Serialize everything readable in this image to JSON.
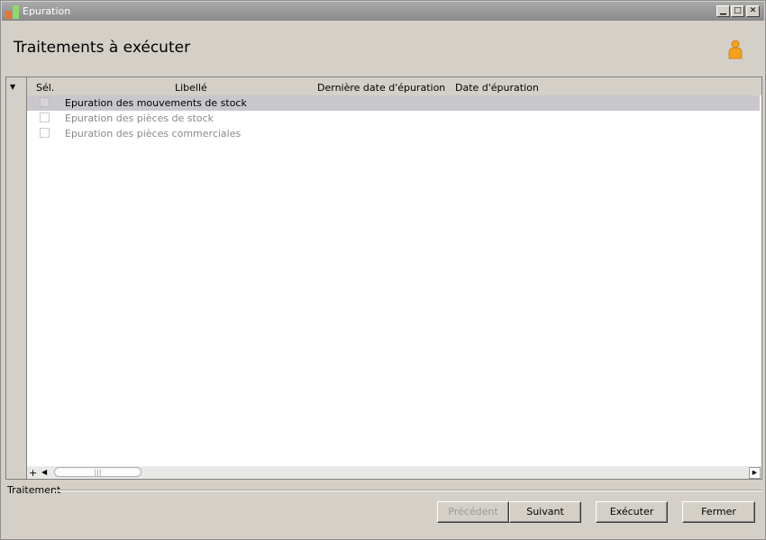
{
  "window": {
    "title": "Epuration",
    "min_glyph": "▁",
    "max_glyph": "□",
    "close_glyph": "✕"
  },
  "page": {
    "title": "Traitements à exécuter"
  },
  "icons": {
    "user": "user-icon",
    "accent": "#f4a21c"
  },
  "grid": {
    "menu_glyph": "▼",
    "columns": [
      "Sél.",
      "Libellé",
      "Dernière date d'épuration",
      "Date d'épuration"
    ],
    "rows": [
      {
        "label": "Epuration des mouvements de stock",
        "selected": true
      },
      {
        "label": "Epuration des pièces de stock",
        "selected": false
      },
      {
        "label": "Epuration des pièces commerciales",
        "selected": false
      }
    ],
    "scroll": {
      "plus": "+",
      "left": "◀",
      "thumb": "|||",
      "right": "▶"
    }
  },
  "group": {
    "label": "Traitement"
  },
  "buttons": {
    "previous": "Précédent",
    "next": "Suivant",
    "execute": "Exécuter",
    "close": "Fermer"
  }
}
